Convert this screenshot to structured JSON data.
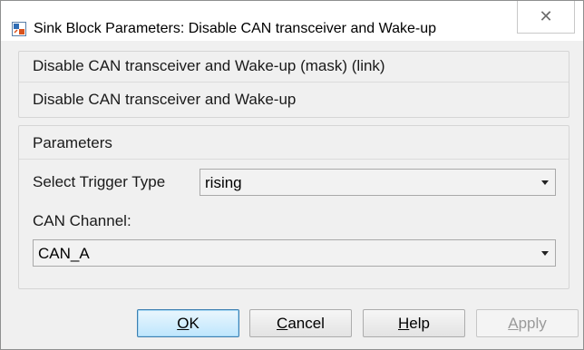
{
  "window": {
    "title": "Sink Block Parameters: Disable CAN transceiver and Wake-up",
    "close_glyph": "✕"
  },
  "description": {
    "heading": "Disable CAN transceiver and Wake-up (mask) (link)",
    "text": "Disable CAN transceiver and Wake-up"
  },
  "parameters": {
    "group_label": "Parameters",
    "trigger_label": "Select Trigger Type",
    "trigger_value": "rising",
    "channel_label": "CAN Channel:",
    "channel_value": "CAN_A"
  },
  "buttons": {
    "ok": {
      "mnemonic": "O",
      "rest": "K"
    },
    "cancel": {
      "mnemonic": "C",
      "rest": "ancel"
    },
    "help": {
      "mnemonic": "H",
      "rest": "elp"
    },
    "apply": {
      "mnemonic": "A",
      "rest": "pply"
    }
  }
}
